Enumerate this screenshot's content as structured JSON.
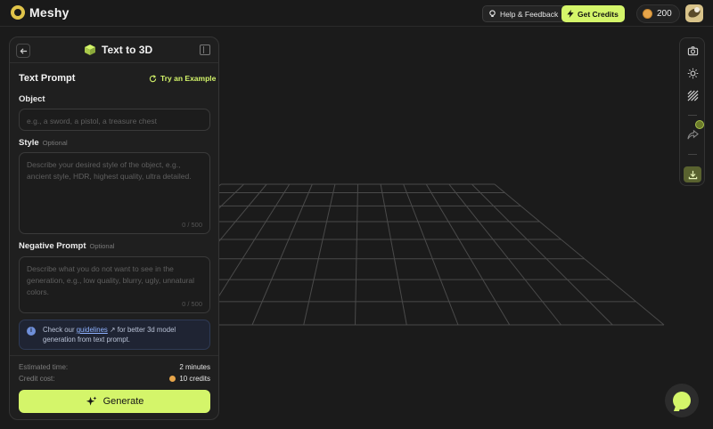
{
  "app": {
    "name": "Meshy"
  },
  "topbar": {
    "help_label": "Help & Feedback",
    "credits_label": "Get Credits",
    "coin_balance": "200"
  },
  "panel": {
    "title": "Text to 3D",
    "section_title": "Text Prompt",
    "example_label": "Try an Example",
    "object": {
      "label": "Object",
      "placeholder": "e.g., a sword, a pistol, a treasure chest"
    },
    "style": {
      "label": "Style",
      "optional": "Optional",
      "placeholder": "Describe your desired style of the object, e.g., ancient style, HDR, highest quality, ultra detailed.",
      "counter": "0 / 500"
    },
    "negative": {
      "label": "Negative Prompt",
      "optional": "Optional",
      "placeholder": "Describe what you do not want to see in the generation, e.g., low quality, blurry, ugly, unnatural colors.",
      "counter": "0 / 500"
    },
    "info": {
      "prefix": "Check our ",
      "link": "guidelines",
      "suffix": " for better 3d model generation from text prompt."
    },
    "estimated_time_label": "Estimated time:",
    "estimated_time_value": "2 minutes",
    "credit_cost_label": "Credit cost:",
    "credit_cost_value": "10 credits",
    "generate_label": "Generate"
  },
  "toolbar": {
    "tools": [
      "camera-icon",
      "sun-icon",
      "texture-icon",
      "share-icon",
      "download-icon"
    ]
  },
  "colors": {
    "accent": "#d4f56a",
    "background": "#1b1b1b",
    "panel": "#1f1f1f"
  }
}
